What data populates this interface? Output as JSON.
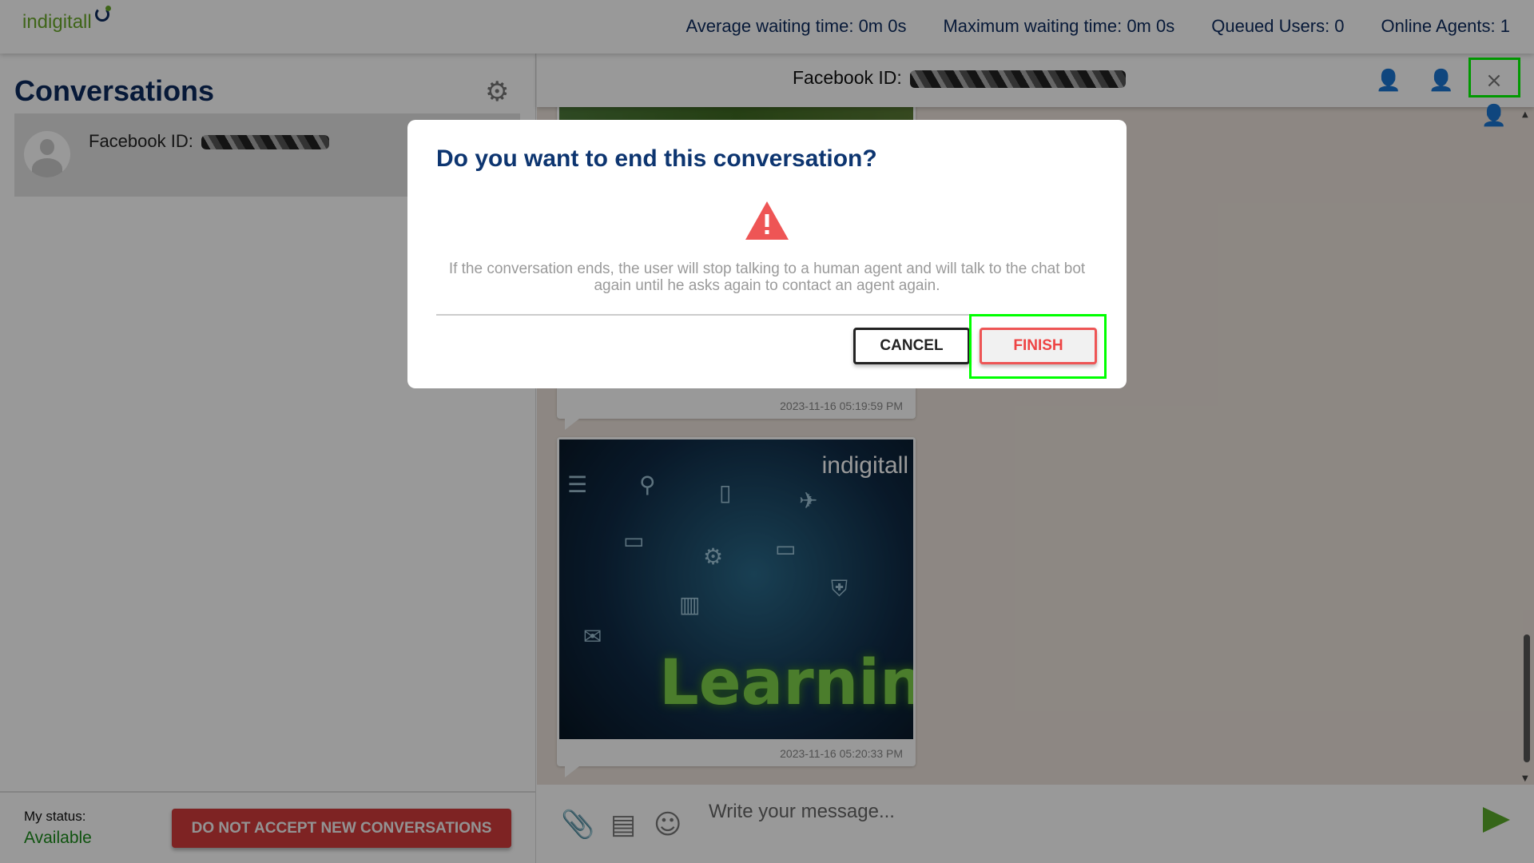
{
  "header": {
    "logo": "indigitall",
    "stats": [
      "Average waiting time: 0m 0s",
      "Maximum waiting time: 0m 0s",
      "Queued Users: 0",
      "Online Agents: 1"
    ]
  },
  "sidebar": {
    "title": "Conversations",
    "items": [
      {
        "label": "Facebook ID:"
      }
    ],
    "status_label": "My status:",
    "status_value": "Available",
    "toggle_button": "DO NOT ACCEPT NEW CONVERSATIONS"
  },
  "chat": {
    "header_label": "Facebook ID:",
    "header_icons": [
      "transfer-user-icon",
      "block-user-icon",
      "end-conversation-icon"
    ],
    "messages": [
      {
        "timestamp": "2023-11-16 05:19:59 PM"
      },
      {
        "image_brand": "indigitall",
        "image_text": "Learning",
        "timestamp": "2023-11-16 05:20:33 PM"
      }
    ],
    "input_placeholder": "Write your message..."
  },
  "modal": {
    "title": "Do you want to end this conversation?",
    "body": "If the conversation ends, the user will stop talking to a human agent and will talk to the chat bot again until he asks again to contact an agent again.",
    "cancel": "CANCEL",
    "finish": "FINISH"
  },
  "colors": {
    "brand_green": "#6aa92a",
    "navy": "#0d2b5e",
    "danger": "#ee5555",
    "highlight": "#00ff00"
  }
}
